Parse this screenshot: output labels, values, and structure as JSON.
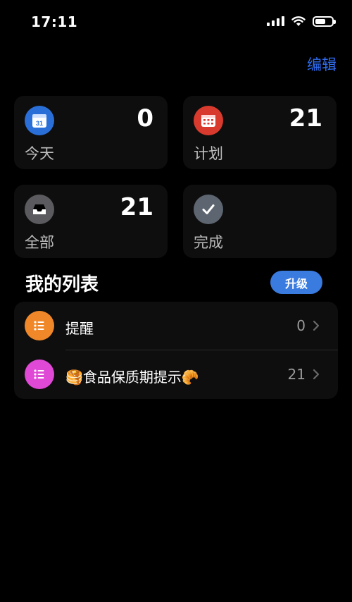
{
  "status": {
    "time": "17:11"
  },
  "header": {
    "edit_label": "编辑",
    "accent": "#2f6df0"
  },
  "cards": [
    {
      "label": "今天",
      "count": "0",
      "icon": "calendar-today-icon",
      "color": "#2a6fd8"
    },
    {
      "label": "计划",
      "count": "21",
      "icon": "calendar-grid-icon",
      "color": "#d93a2e"
    },
    {
      "label": "全部",
      "count": "21",
      "icon": "tray-icon",
      "color": "#5b5b5f"
    },
    {
      "label": "完成",
      "count": "",
      "icon": "checkmark-icon",
      "color": "#5d6670"
    }
  ],
  "calendar_day": "31",
  "my_lists": {
    "title": "我的列表",
    "upgrade_label": "升级",
    "items": [
      {
        "name": "提醒",
        "count": "0",
        "icon": "list-bullet-icon",
        "color": "#f0882a"
      },
      {
        "name": "🥞食品保质期提示🥐",
        "count": "21",
        "icon": "list-bullet-icon",
        "color": "#e048d6"
      }
    ]
  }
}
